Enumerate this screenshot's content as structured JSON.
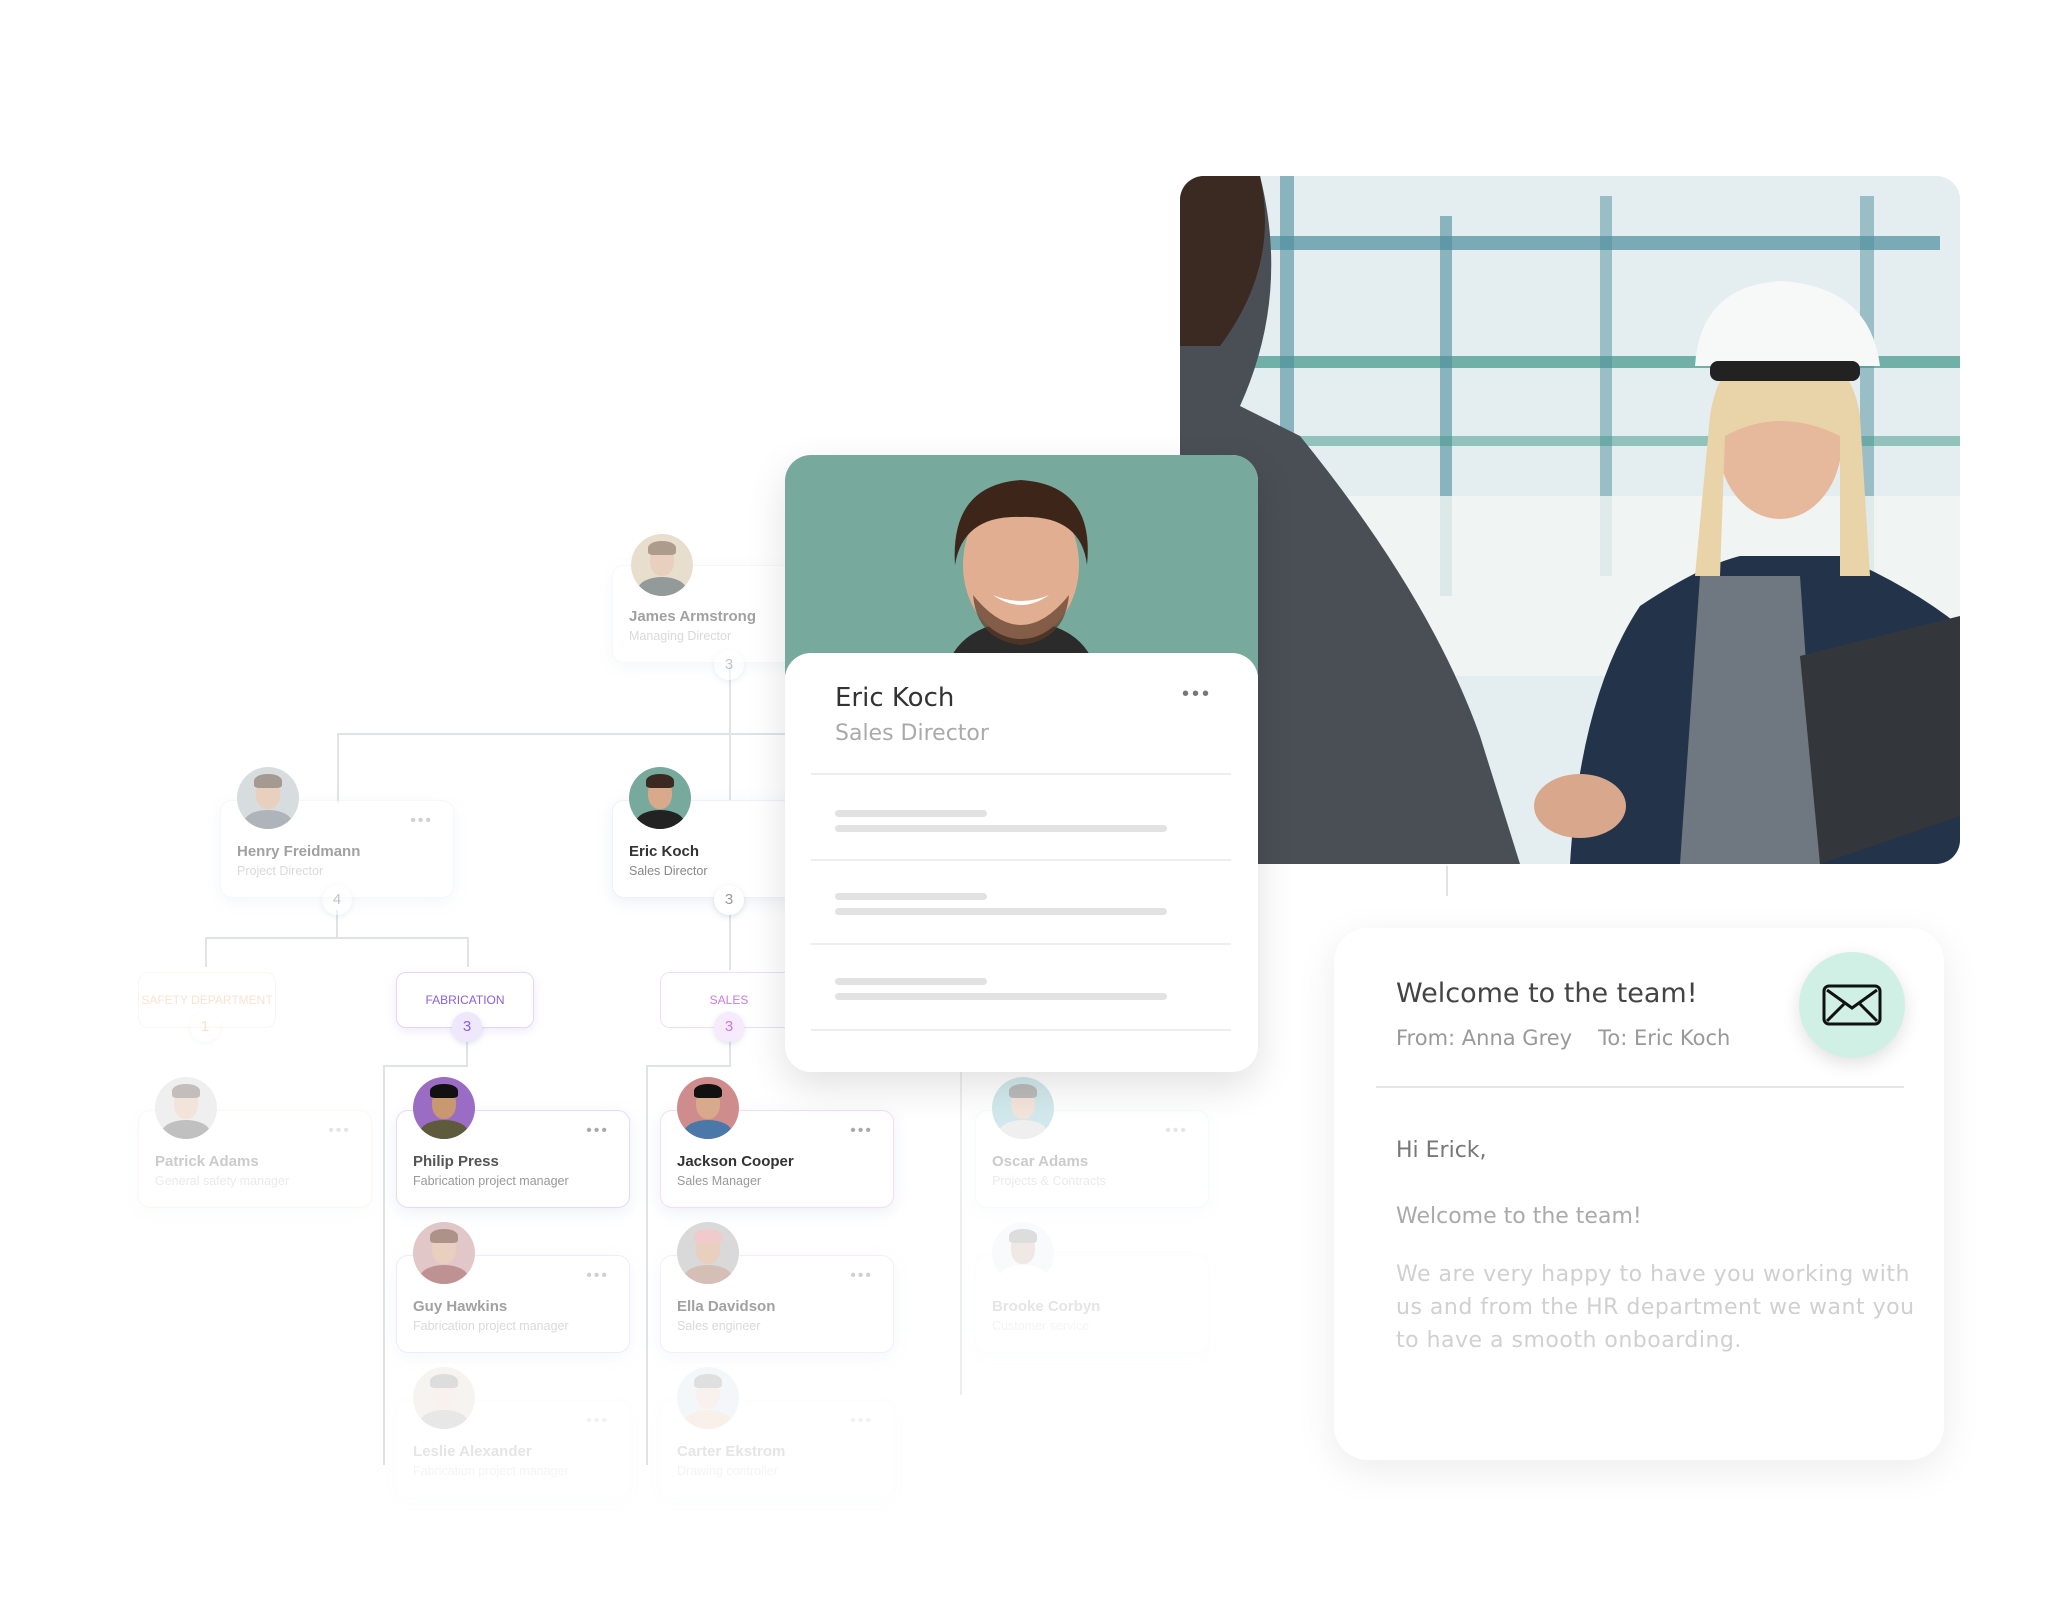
{
  "org_chart": {
    "root": {
      "name": "James Armstrong",
      "role": "Managing Director",
      "count": "3"
    },
    "directors": [
      {
        "name": "Henry Freidmann",
        "role": "Project Director",
        "count": "4"
      },
      {
        "name": "Eric Koch",
        "role": "Sales Director",
        "count": "3"
      }
    ],
    "departments": [
      {
        "label": "SAFETY DEPARTMENT",
        "count": "1",
        "color": "#f0b28a"
      },
      {
        "label": "FABRICATION",
        "count": "3",
        "color": "#8a5fe0"
      },
      {
        "label": "SALES",
        "count": "3",
        "color": "#c77be0"
      }
    ],
    "employees": [
      {
        "name": "Patrick Adams",
        "role": "General safety manager"
      },
      {
        "name": "Philip Press",
        "role": "Fabrication project manager"
      },
      {
        "name": "Guy Hawkins",
        "role": "Fabrication project manager"
      },
      {
        "name": "Leslie Alexander",
        "role": "Fabrication project manager"
      },
      {
        "name": "Jackson Cooper",
        "role": "Sales Manager"
      },
      {
        "name": "Ella Davidson",
        "role": "Sales engineer"
      },
      {
        "name": "Carter Ekstrom",
        "role": "Drawing controller"
      },
      {
        "name": "Oscar Adams",
        "role": "Projects & Contracts"
      },
      {
        "name": "Brooke Corbyn",
        "role": "Customer service"
      }
    ],
    "more_icon": "more-horizontal-icon"
  },
  "profile_card": {
    "name": "Eric Koch",
    "role": "Sales Director",
    "banner_color": "#78a99d",
    "more_icon": "more-horizontal-icon"
  },
  "photo": {
    "description": "Handshake between businessman and female engineer in hard hat at industrial facility"
  },
  "email": {
    "subject": "Welcome to the team!",
    "from": "From: Anna Grey",
    "to": "To: Eric Koch",
    "icon": "envelope-icon",
    "icon_bg": "#d0efe5",
    "greeting": "Hi Erick,",
    "welcome_line": "Welcome to the team!",
    "body": "We are very happy to have you working with us and from the HR department we want you to have a smooth onboarding."
  }
}
